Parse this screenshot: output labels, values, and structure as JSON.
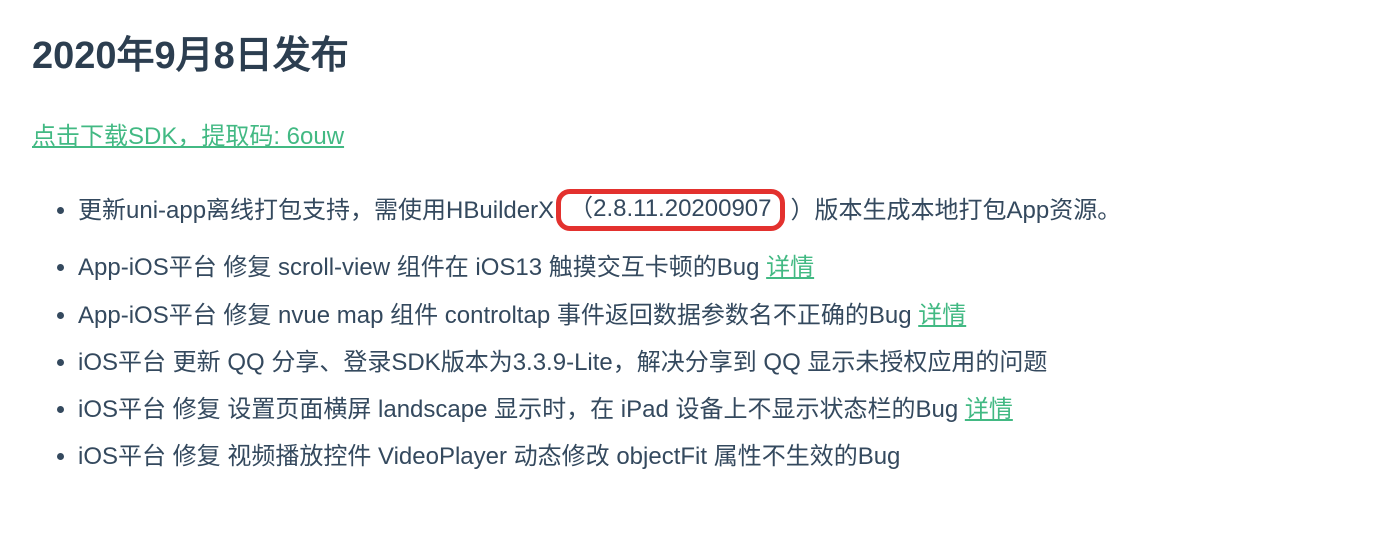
{
  "title": "2020年9月8日发布",
  "download_link": "点击下载SDK，提取码: 6ouw",
  "items": {
    "i1_pre": "更新uni-app离线打包支持，需使用HBuilderX",
    "i1_ver_open": "（",
    "i1_ver_num": "2.8.11.20200907",
    "i1_post": "）版本生成本地打包App资源。",
    "i2_text": "App-iOS平台 修复 scroll-view 组件在 iOS13 触摸交互卡顿的Bug ",
    "i2_link": "详情",
    "i3_text": "App-iOS平台 修复 nvue map 组件 controltap 事件返回数据参数名不正确的Bug ",
    "i3_link": "详情",
    "i4_text": "iOS平台 更新 QQ 分享、登录SDK版本为3.3.9-Lite，解决分享到 QQ 显示未授权应用的问题",
    "i5_text": "iOS平台 修复 设置页面横屏 landscape 显示时，在 iPad 设备上不显示状态栏的Bug ",
    "i5_link": "详情",
    "i6_text": "iOS平台 修复 视频播放控件 VideoPlayer 动态修改 objectFit 属性不生效的Bug"
  }
}
